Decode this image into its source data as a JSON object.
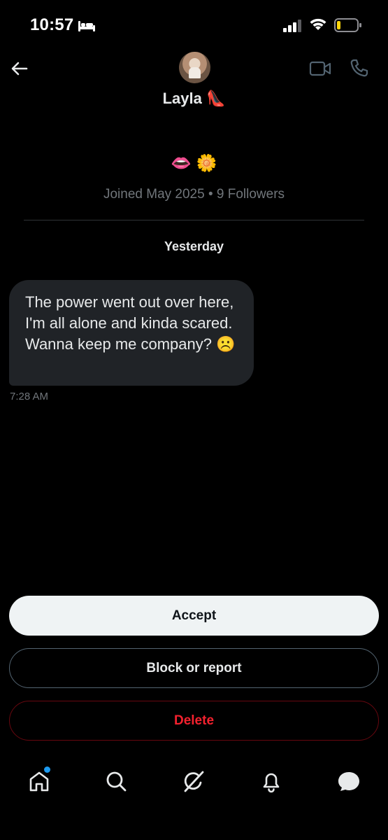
{
  "status_bar": {
    "time": "10:57",
    "bed_icon": "bed-icon",
    "signal_icon": "cellular-signal-icon",
    "wifi_icon": "wifi-icon",
    "battery_icon": "battery-icon",
    "battery_level": 0.15
  },
  "header": {
    "back_icon": "back-arrow-icon",
    "display_name": "Layla 👠",
    "video_icon": "video-call-icon",
    "phone_icon": "phone-call-icon"
  },
  "profile": {
    "bio": "👄 🌼",
    "meta": "Joined May 2025 • 9 Followers"
  },
  "conversation": {
    "day_label": "Yesterday",
    "messages": [
      {
        "text": "The power went out over here, I'm all alone and kinda scared. Wanna keep me company? ☹️",
        "time": "7:28 AM"
      }
    ]
  },
  "actions": {
    "accept_label": "Accept",
    "block_label": "Block or report",
    "delete_label": "Delete"
  },
  "bottom_nav": {
    "items": [
      "home-icon",
      "search-icon",
      "grok-icon",
      "notifications-bell-icon",
      "messages-icon"
    ],
    "home_has_notification": true
  },
  "colors": {
    "background": "#000000",
    "text_primary": "#e7e9ea",
    "text_secondary": "#71767b",
    "accent_blue": "#1d9bf0",
    "danger_red": "#f4212e",
    "bubble_bg": "#202327"
  }
}
